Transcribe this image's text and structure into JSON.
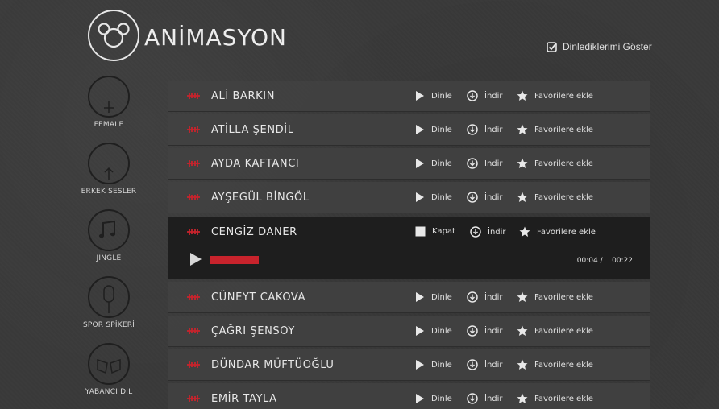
{
  "header": {
    "brand": "ANİMASYON",
    "show_listened_label": "Dinlediklerimi Göster",
    "show_listened_checked": true
  },
  "categories": [
    {
      "label": "FEMALE",
      "icon": "venus-icon"
    },
    {
      "label": "ERKEK SESLER",
      "icon": "mars-icon"
    },
    {
      "label": "JINGLE",
      "icon": "music-note-icon"
    },
    {
      "label": "SPOR SPİKERİ",
      "icon": "microphone-icon"
    },
    {
      "label": "YABANCI DİL",
      "icon": "book-icon"
    }
  ],
  "actions": {
    "listen": "Dinle",
    "close": "Kapat",
    "download": "İndir",
    "favorite": "Favorilere ekle"
  },
  "artists": [
    {
      "name": "ALİ BARKIN"
    },
    {
      "name": "ATİLLA ŞENDİL"
    },
    {
      "name": "AYDA KAFTANCI"
    },
    {
      "name": "AYŞEGÜL BİNGÖL"
    },
    {
      "name": "CENGİZ DANER",
      "open": true
    },
    {
      "name": "CÜNEYT CAKOVA"
    },
    {
      "name": "ÇAĞRI ŞENSOY"
    },
    {
      "name": "DÜNDAR MÜFTÜOĞLU"
    },
    {
      "name": "EMİR TAYLA"
    }
  ],
  "player": {
    "current_time": "00:04",
    "separator": "/",
    "total_time": "00:22",
    "progress": 0.18
  },
  "colors": {
    "accent": "#c8232c",
    "row_bg": "#414141",
    "open_row_bg": "#1e1e1e"
  }
}
